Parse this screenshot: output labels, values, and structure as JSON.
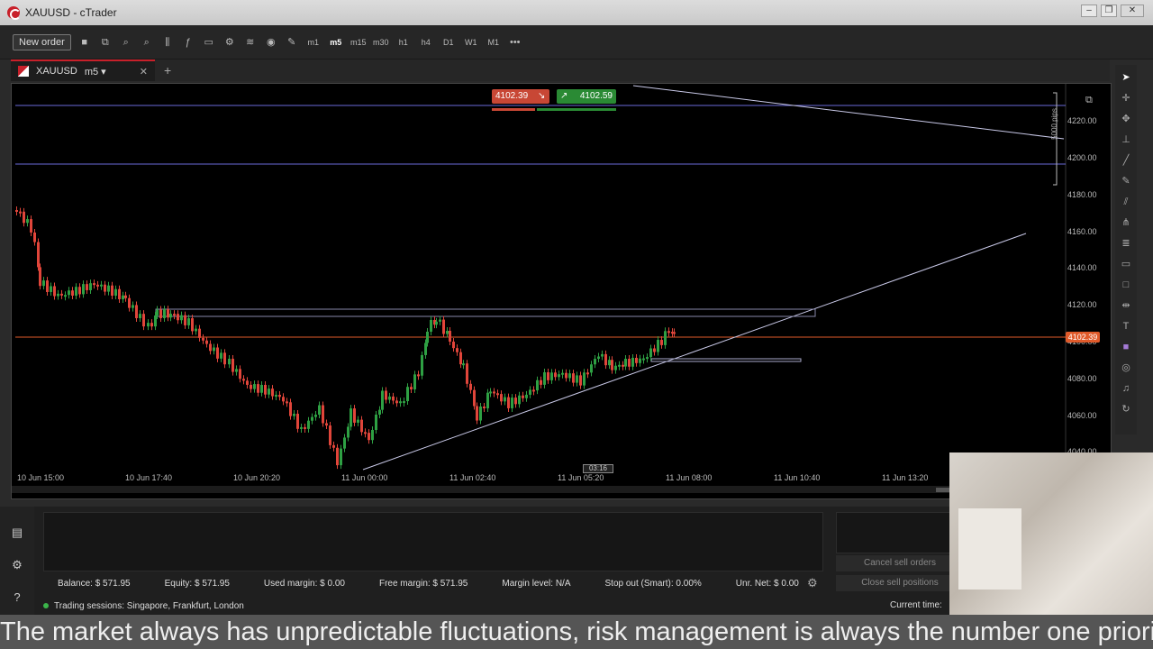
{
  "window": {
    "title": "XAUUSD - cTrader",
    "buttons": [
      "‒",
      "❐",
      "✕"
    ]
  },
  "toolbar": {
    "new_order_label": "New order",
    "timeframes": [
      "m1",
      "m5",
      "m15",
      "m30",
      "h1",
      "h4",
      "D1",
      "W1",
      "M1"
    ],
    "selected_timeframe": "m5",
    "more_label": "•••"
  },
  "tab": {
    "symbol": "XAUUSD",
    "timeframe": "m5 ▾",
    "close": "✕",
    "add": "+"
  },
  "chart": {
    "sell_price": "4102.39",
    "buy_price": "4102.59",
    "pip_label": "5000 pips",
    "current_price": "4102.39",
    "time_marker": "03:16",
    "y_ticks": [
      "4220.00",
      "4200.00",
      "4180.00",
      "4160.00",
      "4140.00",
      "4120.00",
      "4100.00",
      "4080.00",
      "4060.00",
      "4040.00"
    ],
    "x_ticks": [
      "10 Jun 15:00",
      "10 Jun 17:40",
      "10 Jun 20:20",
      "11 Jun 00:00",
      "11 Jun 02:40",
      "11 Jun 05:20",
      "11 Jun 08:00",
      "11 Jun 10:40",
      "11 Jun 13:20"
    ],
    "colors": {
      "up": "#2ea043",
      "down": "#e0453a",
      "price_line": "#e05a2a",
      "trend": "#c9c9e8",
      "level": "#6a6ad8"
    }
  },
  "account": {
    "balance": "Balance: $ 571.95",
    "equity": "Equity: $ 571.95",
    "used_margin": "Used margin: $ 0.00",
    "free_margin": "Free margin: $ 571.95",
    "margin_level": "Margin level: N/A",
    "stop_out": "Stop out (Smart): 0.00%",
    "unr_net": "Unr. Net:  $ 0.00"
  },
  "side_buttons": {
    "cancel_sell": "Cancel sell orders",
    "close_sell": "Close sell positions"
  },
  "status": {
    "sessions": "Trading sessions: Singapore, Frankfurt, London",
    "current_time": "Current time:"
  },
  "subtitle": "The market always has unpredictable fluctuations, risk management is always the number one priority"
}
